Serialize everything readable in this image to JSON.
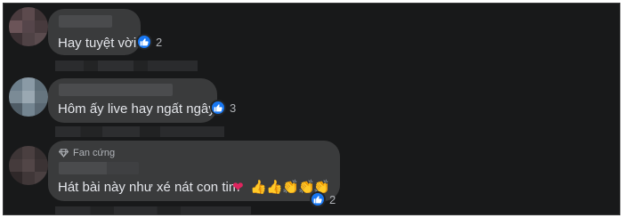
{
  "comments": [
    {
      "text": "Hay tuyệt vời",
      "like_count": "2",
      "reaction_icon": "thumbs-up-icon"
    },
    {
      "text": "Hôm ấy live hay ngất ngây",
      "like_count": "3",
      "reaction_icon": "thumbs-up-icon"
    },
    {
      "badge": "Fan cứng",
      "badge_icon": "diamond-icon",
      "text": "Hát bài này như xé nát con tim",
      "emojis": [
        "❤",
        "👍",
        "👍",
        "👏",
        "👏",
        "👏"
      ],
      "like_count": "2",
      "reaction_icon": "thumbs-up-icon"
    }
  ],
  "colors": {
    "background": "#18191a",
    "bubble": "#3a3b3c",
    "text": "#e4e6eb",
    "secondary_text": "#b0b3b8",
    "like_blue": "#1877f2"
  }
}
